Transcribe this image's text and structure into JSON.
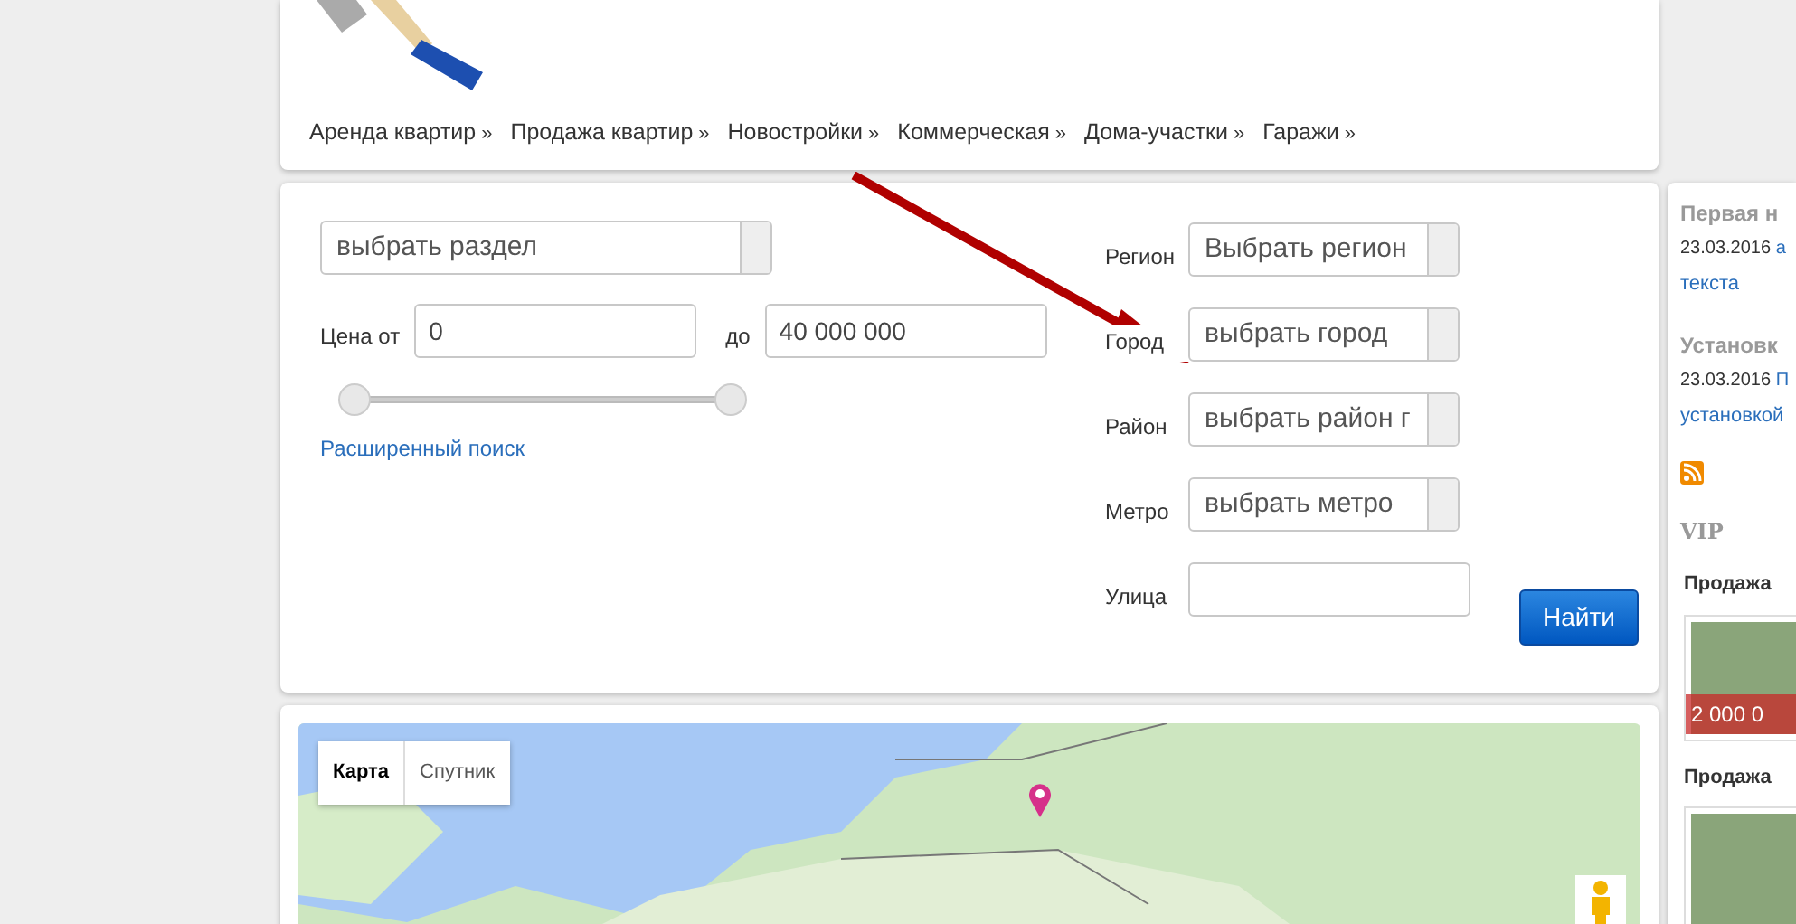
{
  "nav": [
    {
      "label": "Аренда квартир",
      "marker": "»"
    },
    {
      "label": "Продажа квартир",
      "marker": "»"
    },
    {
      "label": "Новостройки",
      "marker": "»"
    },
    {
      "label": "Коммерческая",
      "marker": "»"
    },
    {
      "label": "Дома-участки",
      "marker": "»"
    },
    {
      "label": "Гаражи",
      "marker": "»"
    }
  ],
  "search": {
    "section_select": "выбрать раздел",
    "price_from_label": "Цена от",
    "price_from": "0",
    "price_to_label": "до",
    "price_to": "40 000 000",
    "price_slider": [
      {
        "level": 0
      },
      {
        "level": 1
      }
    ],
    "advanced_link": "Расширенный поиск",
    "filters": [
      {
        "label": "Регион",
        "kind": "select",
        "value": "Выбрать регион"
      },
      {
        "label": "Город",
        "kind": "select",
        "value": "выбрать город"
      },
      {
        "label": "Район",
        "kind": "select",
        "value": "выбрать район г"
      },
      {
        "label": "Метро",
        "kind": "select",
        "value": "выбрать метро"
      },
      {
        "label": "Улица",
        "kind": "input"
      }
    ],
    "submit": "Найти"
  },
  "map": {
    "types": [
      {
        "label": "Карта",
        "selected": true
      },
      {
        "label": "Спутник",
        "selected": false
      }
    ]
  },
  "sidebar": {
    "news": [
      {
        "title": "Первая н",
        "date": "23.03.2016",
        "link_lines": [
          "а",
          "текста"
        ]
      },
      {
        "title": "Установк",
        "date": "23.03.2016",
        "link_lines": [
          "П",
          "установкой"
        ]
      }
    ],
    "vip_heading": "VIP",
    "vip": [
      {
        "title": "Продажа",
        "price": "2 000 0"
      },
      {
        "title": "Продажа"
      }
    ]
  }
}
